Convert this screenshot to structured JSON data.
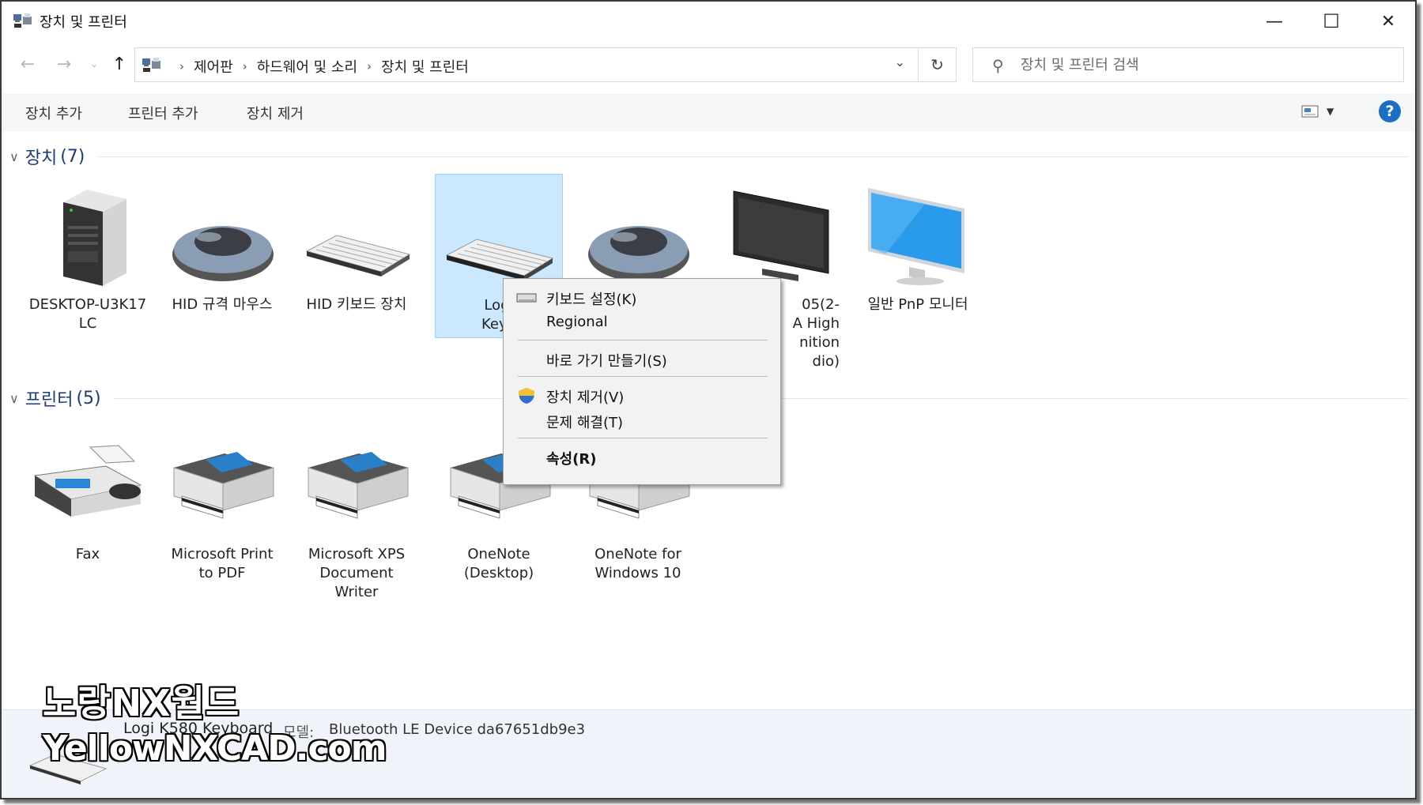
{
  "window": {
    "title": "장치 및 프린터",
    "controls": {
      "minimize": "—",
      "maximize": "☐",
      "close": "✕"
    }
  },
  "address": {
    "crumbs": [
      "제어판",
      "하드웨어 및 소리",
      "장치 및 프린터"
    ],
    "search_placeholder": "장치 및 프린터 검색"
  },
  "commands": [
    "장치 추가",
    "프린터 추가",
    "장치 제거"
  ],
  "help_label": "?",
  "sections": {
    "devices": {
      "label": "장치",
      "count": "(7)"
    },
    "printers": {
      "label": "프린터",
      "count": "(5)"
    }
  },
  "devices": [
    {
      "icon": "computer-tower-icon",
      "line1": "DESKTOP-U3K17",
      "line2": "LC",
      "line3": "",
      "line4": ""
    },
    {
      "icon": "mouse-icon",
      "line1": "HID 규격 마우스",
      "line2": "",
      "line3": "",
      "line4": ""
    },
    {
      "icon": "keyboard-icon",
      "line1": "HID 키보드 장치",
      "line2": "",
      "line3": "",
      "line4": ""
    },
    {
      "icon": "keyboard-icon",
      "line1": "Logi",
      "line2": "Keyb",
      "line3": "",
      "line4": ""
    },
    {
      "icon": "mouse-icon",
      "line1": "",
      "line2": "",
      "line3": "",
      "line4": ""
    },
    {
      "icon": "monitor-dark-icon",
      "line1": "05(2-",
      "line2": "A High",
      "line3": "nition",
      "line4": "dio)"
    },
    {
      "icon": "monitor-icon",
      "line1": "일반 PnP 모니터",
      "line2": "",
      "line3": "",
      "line4": ""
    }
  ],
  "printers": [
    {
      "icon": "fax-icon",
      "line1": "Fax",
      "line2": "",
      "line3": ""
    },
    {
      "icon": "printer-icon",
      "line1": "Microsoft Print",
      "line2": "to PDF",
      "line3": ""
    },
    {
      "icon": "printer-icon",
      "line1": "Microsoft XPS",
      "line2": "Document",
      "line3": "Writer"
    },
    {
      "icon": "printer-icon",
      "line1": "OneNote",
      "line2": "(Desktop)",
      "line3": ""
    },
    {
      "icon": "printer-icon",
      "line1": "OneNote for",
      "line2": "Windows 10",
      "line3": ""
    }
  ],
  "context_menu": {
    "keyboard_settings": "키보드 설정(K)",
    "regional": "Regional",
    "create_shortcut": "바로 가기 만들기(S)",
    "remove_device": "장치 제거(V)",
    "troubleshoot": "문제 해결(T)",
    "properties": "속성(R)"
  },
  "details": {
    "device_name": "Logi K580 Keyboard",
    "model_label": "모델:",
    "model_value": "Bluetooth LE Device da67651db9e3"
  },
  "watermark": {
    "line1": "노랑NX월드",
    "line2": "YellowNXCAD.com"
  },
  "colors": {
    "selection": "#cce8ff",
    "help_blue": "#1a6fc4",
    "section_text": "#1e3a78",
    "monitor_blue": "#2a9bea"
  }
}
